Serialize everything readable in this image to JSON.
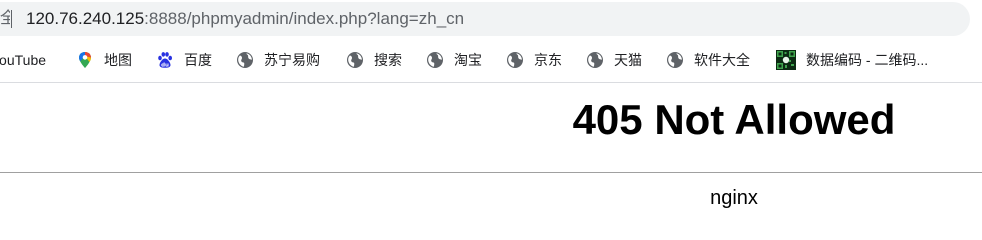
{
  "address_bar": {
    "security_label": "全",
    "url_host": "120.76.240.125",
    "url_rest": ":8888/phpmyadmin/index.php?lang=zh_cn"
  },
  "bookmarks": [
    {
      "label": "YouTube",
      "icon": "youtube-icon"
    },
    {
      "label": "地图",
      "icon": "maps-pin-icon"
    },
    {
      "label": "百度",
      "icon": "baidu-paw-icon"
    },
    {
      "label": "苏宁易购",
      "icon": "globe-icon"
    },
    {
      "label": "搜索",
      "icon": "globe-icon"
    },
    {
      "label": "淘宝",
      "icon": "globe-icon"
    },
    {
      "label": "京东",
      "icon": "globe-icon"
    },
    {
      "label": "天猫",
      "icon": "globe-icon"
    },
    {
      "label": "软件大全",
      "icon": "globe-icon"
    },
    {
      "label": "数据编码 - 二维码...",
      "icon": "qr-code-icon"
    }
  ],
  "page": {
    "heading": "405 Not Allowed",
    "server": "nginx"
  },
  "colors": {
    "address_bar_bg": "#f1f3f4",
    "text_primary": "#202124",
    "text_secondary": "#5f6368",
    "globe_icon": "#5f6368",
    "baidu_blue": "#2932e1",
    "divider": "#a0a0a0"
  }
}
